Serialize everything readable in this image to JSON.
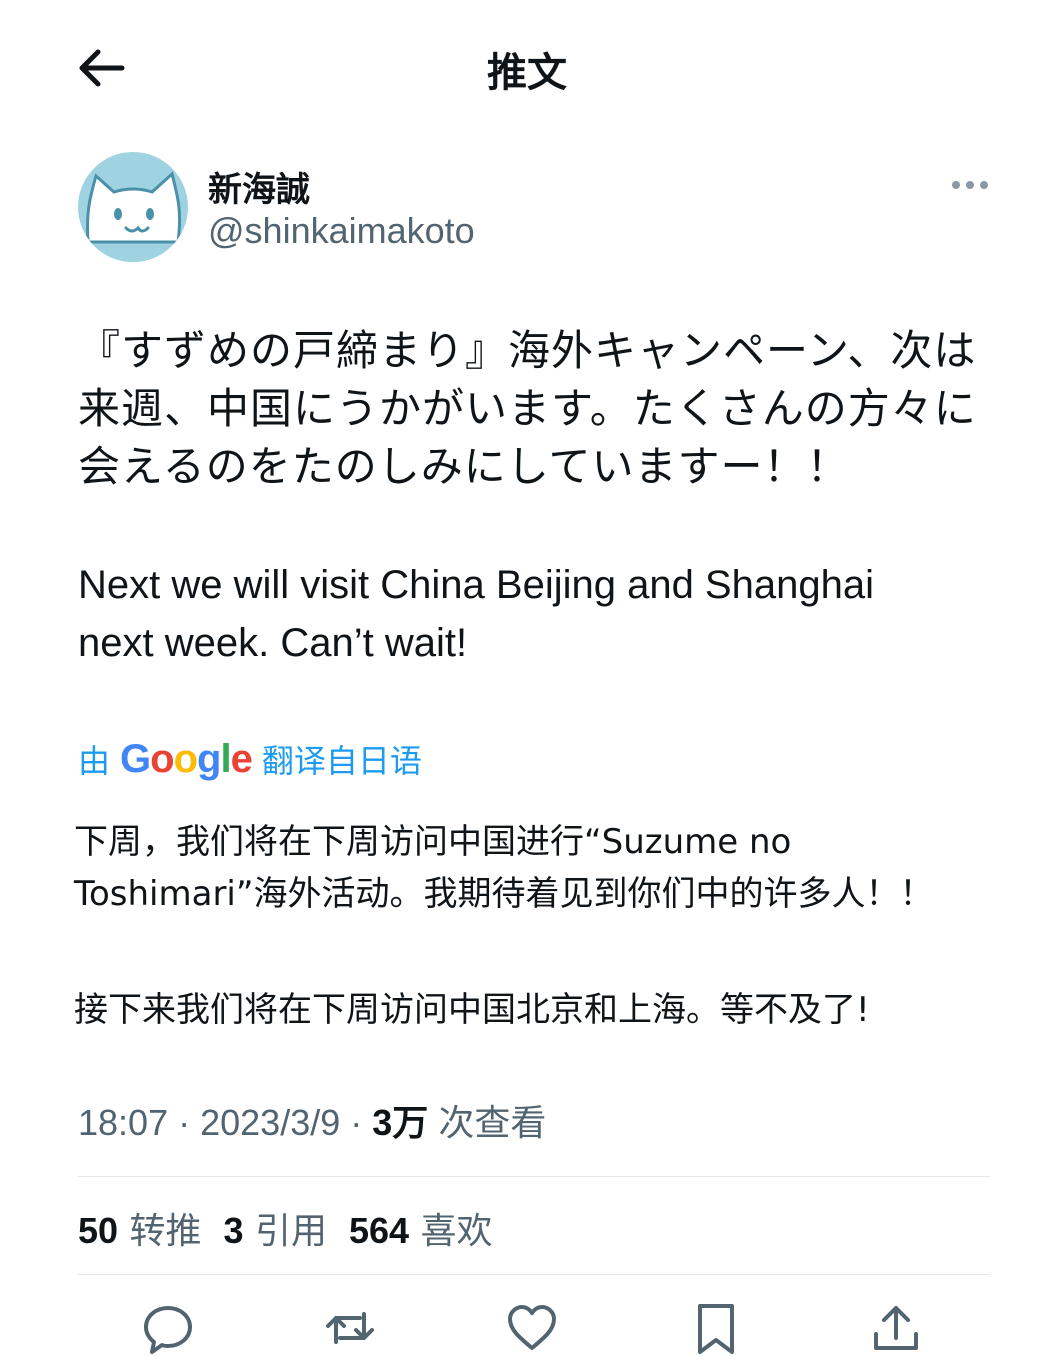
{
  "header": {
    "title": "推文"
  },
  "user": {
    "display_name": "新海誠",
    "handle": "@shinkaimakoto"
  },
  "tweet": {
    "text_ja": "『すずめの戸締まり』海外キャンペーン、次は来週、中国にうかがいます。たくさんの方々に会えるのをたのしみにしていますー！！",
    "text_en_line1": "Next we will visit China Beijing and Shanghai",
    "text_en_line2": "next week. Can’t wait!"
  },
  "translation": {
    "prefix": "由",
    "provider": "Google",
    "suffix": "翻译自日语",
    "text1": "下周，我们将在下周访问中国进行“Suzume no Toshimari”海外活动。我期待着见到你们中的许多人！！",
    "text2": "接下来我们将在下周访问中国北京和上海。等不及了!"
  },
  "meta": {
    "time": "18:07",
    "date": "2023/3/9",
    "views_count": "3万",
    "views_label": "次查看"
  },
  "stats": {
    "retweets_count": "50",
    "retweets_label": "转推",
    "quotes_count": "3",
    "quotes_label": "引用",
    "likes_count": "564",
    "likes_label": "喜欢"
  },
  "colors": {
    "accent": "#1d9bf0",
    "secondary_text": "#536471",
    "avatar_bg": "#9fd3e1"
  },
  "icons": [
    "back-arrow-icon",
    "more-icon",
    "reply-icon",
    "retweet-icon",
    "like-icon",
    "bookmark-icon",
    "share-icon"
  ]
}
